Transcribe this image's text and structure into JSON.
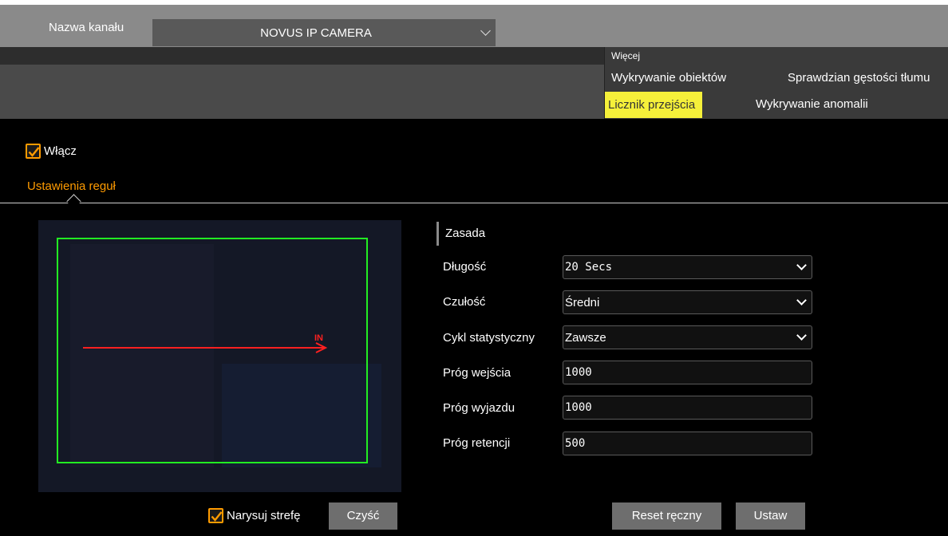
{
  "header": {
    "channel_label": "Nazwa kanału",
    "channel_value": "NOVUS IP CAMERA"
  },
  "more_menu": {
    "title": "Więcej",
    "items": [
      {
        "label": "Wykrywanie obiektów"
      },
      {
        "label": "Sprawdzian gęstości tłumu"
      },
      {
        "label": "Licznik przejścia",
        "active": true
      },
      {
        "label": "Wykrywanie anomalii"
      }
    ]
  },
  "enable": {
    "label": "Włącz",
    "checked": true
  },
  "rules_tab": "Ustawienia reguł",
  "preview": {
    "direction_label": "IN",
    "line_color": "#ff2020",
    "zone_color": "#22ee22"
  },
  "rule": {
    "section_title": "Zasada",
    "fields": [
      {
        "label": "Długość",
        "value": "20 Secs",
        "type": "select"
      },
      {
        "label": "Czułość",
        "value": "Średni",
        "type": "select"
      },
      {
        "label": "Cykl statystyczny",
        "value": "Zawsze",
        "type": "select"
      },
      {
        "label": "Próg wejścia",
        "value": "1000",
        "type": "input"
      },
      {
        "label": "Próg wyjazdu",
        "value": "1000",
        "type": "input"
      },
      {
        "label": "Próg retencji",
        "value": "500",
        "type": "input"
      }
    ]
  },
  "draw_zone": {
    "label": "Narysuj strefę",
    "checked": true
  },
  "buttons": {
    "clear": "Czyść",
    "reset": "Reset ręczny",
    "set": "Ustaw"
  },
  "colors": {
    "accent": "#ff9b00",
    "highlight": "#f5f03a"
  }
}
